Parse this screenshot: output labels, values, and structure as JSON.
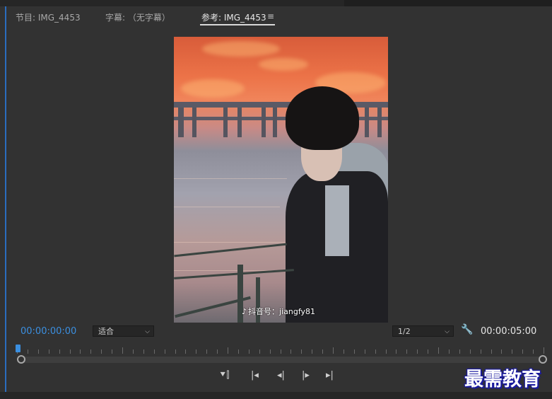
{
  "tabs": [
    {
      "label": "节目: IMG_4453",
      "active": false
    },
    {
      "label": "字幕: （无字幕）",
      "active": false
    },
    {
      "label": "参考: IMG_4453",
      "active": true
    }
  ],
  "tab_menu_icon": "hamburger-icon",
  "video": {
    "watermark_text": "抖音号：jiangfy81",
    "watermark_icon": "tiktok-icon"
  },
  "controls": {
    "current_timecode": "00:00:00:00",
    "zoom_select": "适合",
    "resolution_select": "1/2",
    "duration_timecode": "00:00:05:00",
    "settings_icon": "wrench-icon",
    "buttons": [
      {
        "name": "mark-in-out-button",
        "icon": "marker-icon"
      },
      {
        "name": "go-to-in-button",
        "icon": "step-to-in-icon"
      },
      {
        "name": "step-back-button",
        "icon": "step-back-icon"
      },
      {
        "name": "step-forward-button",
        "icon": "step-forward-icon"
      },
      {
        "name": "go-to-out-button",
        "icon": "step-to-out-icon"
      }
    ]
  },
  "playhead": {
    "position_fraction": 0
  },
  "accent_color": "#3b8fe0",
  "logo_text": "最需教育"
}
